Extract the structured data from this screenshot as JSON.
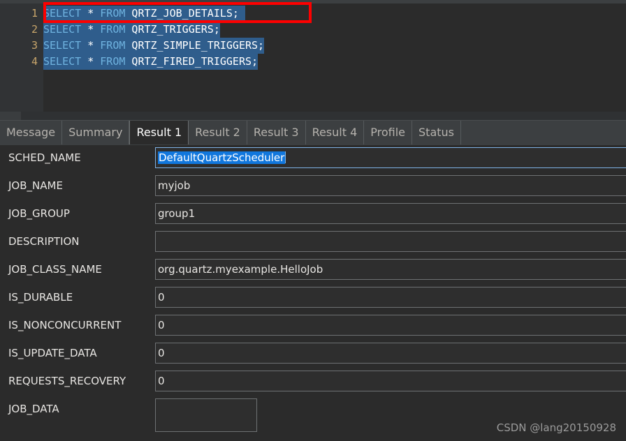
{
  "editor": {
    "lines": [
      {
        "number": "1",
        "keyword1": "SELECT",
        "star": " * ",
        "keyword2": "FROM",
        "table": " QRTZ_JOB_DETAILS; ",
        "text": "SELECT * FROM QRTZ_JOB_DETAILS;"
      },
      {
        "number": "2",
        "keyword1": "SELECT",
        "star": " * ",
        "keyword2": "FROM",
        "table": " QRTZ_TRIGGERS;",
        "text": "SELECT * FROM QRTZ_TRIGGERS;"
      },
      {
        "number": "3",
        "keyword1": "SELECT",
        "star": " * ",
        "keyword2": "FROM",
        "table": " QRTZ_SIMPLE_TRIGGERS;",
        "text": "SELECT * FROM QRTZ_SIMPLE_TRIGGERS;"
      },
      {
        "number": "4",
        "keyword1": "SELECT",
        "star": " * ",
        "keyword2": "FROM",
        "table": " QRTZ_FIRED_TRIGGERS;",
        "text": "SELECT * FROM QRTZ_FIRED_TRIGGERS;"
      }
    ],
    "annotation_color": "#fe0000",
    "keyword_color": "#6fb3e0",
    "selection_color": "#2f5d8c"
  },
  "tabs": [
    {
      "label": "Message",
      "active": false
    },
    {
      "label": "Summary",
      "active": false
    },
    {
      "label": "Result 1",
      "active": true
    },
    {
      "label": "Result 2",
      "active": false
    },
    {
      "label": "Result 3",
      "active": false
    },
    {
      "label": "Result 4",
      "active": false
    },
    {
      "label": "Profile",
      "active": false
    },
    {
      "label": "Status",
      "active": false
    }
  ],
  "form": {
    "fields": [
      {
        "label": "SCHED_NAME",
        "value": "DefaultQuartzScheduler",
        "focused": true,
        "selected": true
      },
      {
        "label": "JOB_NAME",
        "value": "myjob",
        "focused": false,
        "selected": false
      },
      {
        "label": "JOB_GROUP",
        "value": "group1",
        "focused": false,
        "selected": false
      },
      {
        "label": "DESCRIPTION",
        "value": "",
        "focused": false,
        "selected": false
      },
      {
        "label": "JOB_CLASS_NAME",
        "value": "org.quartz.myexample.HelloJob",
        "focused": false,
        "selected": false
      },
      {
        "label": "IS_DURABLE",
        "value": "0",
        "focused": false,
        "selected": false
      },
      {
        "label": "IS_NONCONCURRENT",
        "value": "0",
        "focused": false,
        "selected": false
      },
      {
        "label": "IS_UPDATE_DATA",
        "value": "0",
        "focused": false,
        "selected": false
      },
      {
        "label": "REQUESTS_RECOVERY",
        "value": "0",
        "focused": false,
        "selected": false
      },
      {
        "label": "JOB_DATA",
        "value": "",
        "focused": false,
        "selected": false,
        "small": true
      }
    ]
  },
  "watermark": {
    "text": "CSDN @lang20150928"
  }
}
